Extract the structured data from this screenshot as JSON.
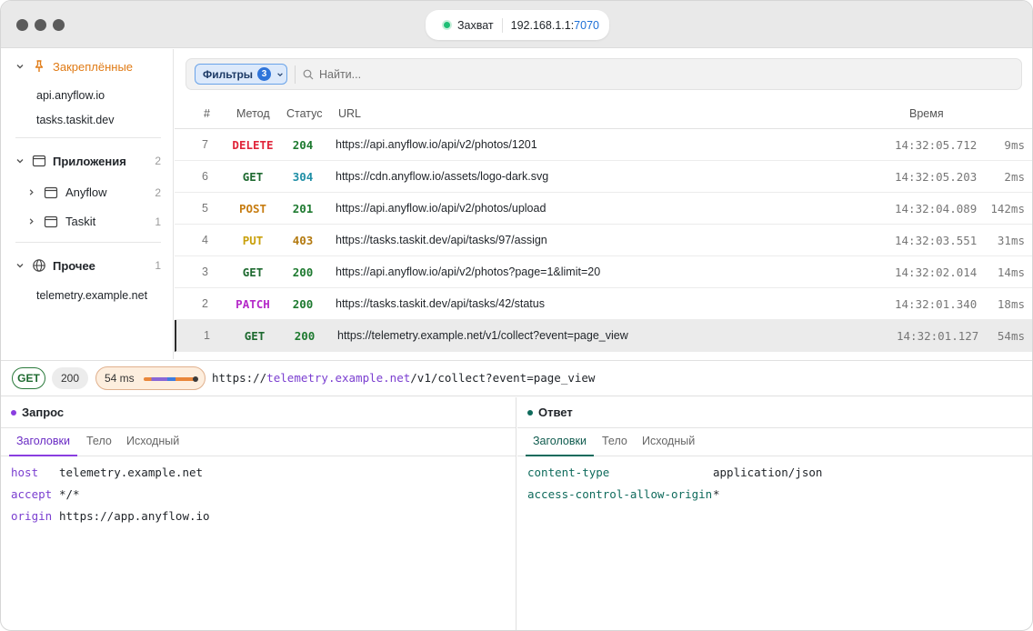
{
  "titlebar": {
    "capture_label": "Захват",
    "host": "192.168.1.1:",
    "port": "7070"
  },
  "sidebar": {
    "pinned": {
      "title": "Закреплённые",
      "items": [
        "api.anyflow.io",
        "tasks.taskit.dev"
      ]
    },
    "apps": {
      "title": "Приложения",
      "count": "2",
      "items": [
        {
          "label": "Anyflow",
          "count": "2"
        },
        {
          "label": "Taskit",
          "count": "1"
        }
      ]
    },
    "other": {
      "title": "Прочее",
      "count": "1",
      "items": [
        "telemetry.example.net"
      ]
    }
  },
  "filters": {
    "label": "Фильтры",
    "count": "3",
    "search_placeholder": "Найти..."
  },
  "table": {
    "columns": {
      "num": "#",
      "method": "Метод",
      "status": "Статус",
      "url": "URL",
      "time": "Время"
    },
    "rows": [
      {
        "num": "7",
        "method": "DELETE",
        "status": "204",
        "url": "https://api.anyflow.io/api/v2/photos/1201",
        "time": "14:32:05.712",
        "duration": "9ms"
      },
      {
        "num": "6",
        "method": "GET",
        "status": "304",
        "url": "https://cdn.anyflow.io/assets/logo-dark.svg",
        "time": "14:32:05.203",
        "duration": "2ms"
      },
      {
        "num": "5",
        "method": "POST",
        "status": "201",
        "url": "https://api.anyflow.io/api/v2/photos/upload",
        "time": "14:32:04.089",
        "duration": "142ms"
      },
      {
        "num": "4",
        "method": "PUT",
        "status": "403",
        "url": "https://tasks.taskit.dev/api/tasks/97/assign",
        "time": "14:32:03.551",
        "duration": "31ms"
      },
      {
        "num": "3",
        "method": "GET",
        "status": "200",
        "url": "https://api.anyflow.io/api/v2/photos?page=1&limit=20",
        "time": "14:32:02.014",
        "duration": "14ms"
      },
      {
        "num": "2",
        "method": "PATCH",
        "status": "200",
        "url": "https://tasks.taskit.dev/api/tasks/42/status",
        "time": "14:32:01.340",
        "duration": "18ms"
      },
      {
        "num": "1",
        "method": "GET",
        "status": "200",
        "url": "https://telemetry.example.net/v1/collect?event=page_view",
        "time": "14:32:01.127",
        "duration": "54ms"
      }
    ]
  },
  "detail": {
    "method": "GET",
    "status": "200",
    "duration": "54 ms",
    "url_scheme": "https://",
    "url_host": "telemetry.example.net",
    "url_path": "/v1/collect?event=page_view"
  },
  "request": {
    "title": "Запрос",
    "tabs": [
      "Заголовки",
      "Тело",
      "Исходный"
    ],
    "headers": [
      {
        "key": "host",
        "value": "telemetry.example.net"
      },
      {
        "key": "accept",
        "value": "*/*"
      },
      {
        "key": "origin",
        "value": "https://app.anyflow.io"
      }
    ]
  },
  "response": {
    "title": "Ответ",
    "tabs": [
      "Заголовки",
      "Тело",
      "Исходный"
    ],
    "headers": [
      {
        "key": "content-type",
        "value": "application/json"
      },
      {
        "key": "access-control-allow-origin",
        "value": "*"
      }
    ]
  },
  "colors": {
    "DELETE": "#e0253a",
    "GET": "#1e6a30",
    "POST": "#c77d12",
    "PUT": "#c9a00c",
    "PATCH": "#b52bc9",
    "status_2xx": "#1e7a30",
    "status_3xx": "#1f8fa6",
    "status_4xx": "#b37a10",
    "request_accent": "#8a3ee0",
    "response_accent": "#0f6b5c"
  }
}
